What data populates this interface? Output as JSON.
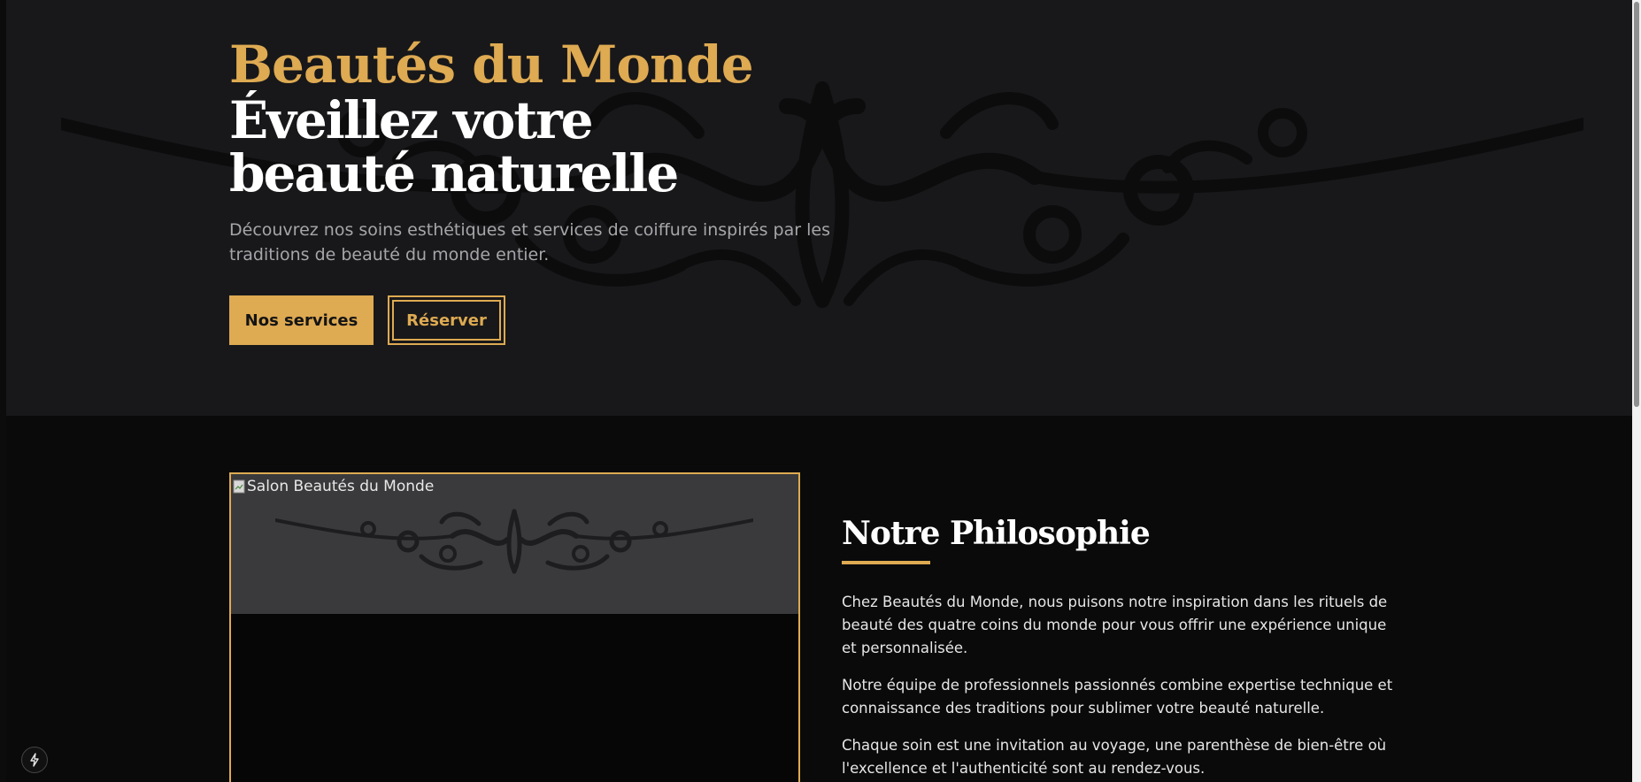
{
  "hero": {
    "brand": "Beautés du Monde",
    "headline": "Éveillez votre beauté naturelle",
    "description": "Découvrez nos soins esthétiques et services de coiffure inspirés par les traditions de beauté du monde entier.",
    "primary_button": "Nos services",
    "secondary_button": "Réserver"
  },
  "philosophy": {
    "image_alt": "Salon Beautés du Monde",
    "title": "Notre Philosophie",
    "paragraphs": [
      "Chez Beautés du Monde, nous puisons notre inspiration dans les rituels de beauté des quatre coins du monde pour vous offrir une expérience unique et personnalisée.",
      "Notre équipe de professionnels passionnés combine expertise technique et connaissance des traditions pour sublimer votre beauté naturelle.",
      "Chaque soin est une invitation au voyage, une parenthèse de bien-être où l'excellence et l'authenticité sont au rendez-vous."
    ]
  },
  "badge_icon": "lightning-icon",
  "colors": {
    "accent": "#deaa52",
    "hero_bg": "#18181a",
    "section_bg": "#0a0a0b",
    "text": "#ffffff",
    "muted_text": "#a6a6aa"
  }
}
